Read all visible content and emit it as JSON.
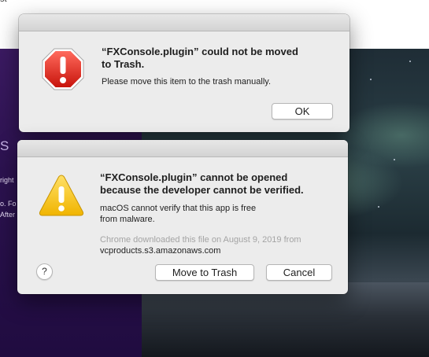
{
  "background": {
    "top_fragment": "st",
    "side_letter": "S",
    "side_fragments": [
      "right",
      "o. Fo",
      "After"
    ]
  },
  "error_dialog": {
    "icon": "stop-error-icon",
    "title_line1": "“FXConsole.plugin” could not be moved",
    "title_line2": "to Trash.",
    "message": "Please move this item to the trash manually.",
    "ok_label": "OK"
  },
  "warning_dialog": {
    "icon": "caution-warning-icon",
    "title_line1": "“FXConsole.plugin” cannot be opened",
    "title_line2": "because the developer cannot be verified.",
    "message_line1": "macOS cannot verify that this app is free",
    "message_line2": "from malware.",
    "download_info": "Chrome downloaded this file on August 9, 2019 from",
    "download_host": "vcproducts.s3.amazonaws.com",
    "help_label": "?",
    "move_to_trash_label": "Move to Trash",
    "cancel_label": "Cancel"
  }
}
